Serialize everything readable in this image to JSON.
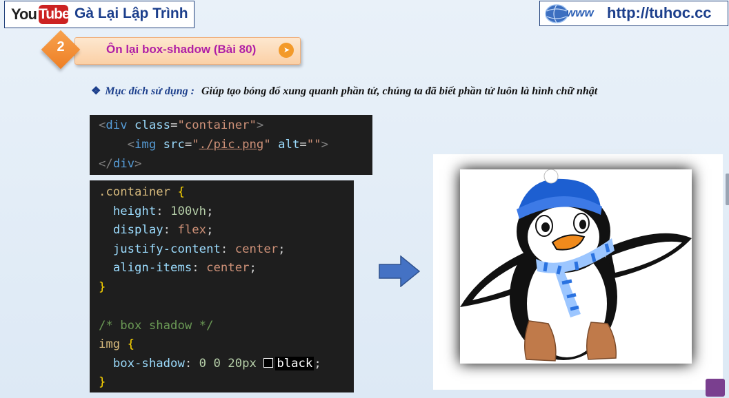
{
  "header": {
    "youtube_you": "You",
    "youtube_tube": "Tube",
    "channel_name": "Gà Lại Lập Trình",
    "site_url": "http://tuhoc.cc"
  },
  "lesson": {
    "number": "2",
    "title": "Ôn lại box-shadow (Bài 80)"
  },
  "purpose": {
    "bullet": "❖",
    "label": "Mục đích sử dụng :",
    "text": "Giúp tạo bóng đổ xung quanh phần tử, chúng ta đã biết phần tử luôn là hình chữ nhật"
  },
  "html_code": {
    "line1": {
      "open": "<",
      "tag": "div",
      "attr": "class",
      "eq": "=",
      "val": "\"container\"",
      "close": ">"
    },
    "line2": {
      "open": "<",
      "tag": "img",
      "attr1": "src",
      "eq1": "=",
      "q1": "\"",
      "path": "./pic.png",
      "q2": "\"",
      "attr2": "alt",
      "eq2": "=",
      "val2": "\"\"",
      "close": ">"
    },
    "line3": {
      "open": "</",
      "tag": "div",
      "close": ">"
    }
  },
  "css_code": {
    "selector1": ".container",
    "brace_open": "{",
    "brace_close": "}",
    "declarations": [
      {
        "prop": "height",
        "value": "100vh",
        "value_kind": "num"
      },
      {
        "prop": "display",
        "value": "flex",
        "value_kind": "kw"
      },
      {
        "prop": "justify-content",
        "value": "center",
        "value_kind": "kw"
      },
      {
        "prop": "align-items",
        "value": "center",
        "value_kind": "kw"
      }
    ],
    "comment": "/* box shadow */",
    "selector2": "img",
    "shadow_prop": "box-shadow",
    "shadow_nums": "0 0 20px",
    "shadow_color": "black"
  },
  "colors": {
    "channel_blue": "#1c3f8c",
    "lesson_title": "#b01fa6",
    "code_bg": "#1e1e1e",
    "arrow_blue": "#4472c4"
  },
  "icons": {
    "globe": "globe-www-icon",
    "arrow": "right-arrow-icon",
    "cursor": "cursor-pointer-icon"
  }
}
